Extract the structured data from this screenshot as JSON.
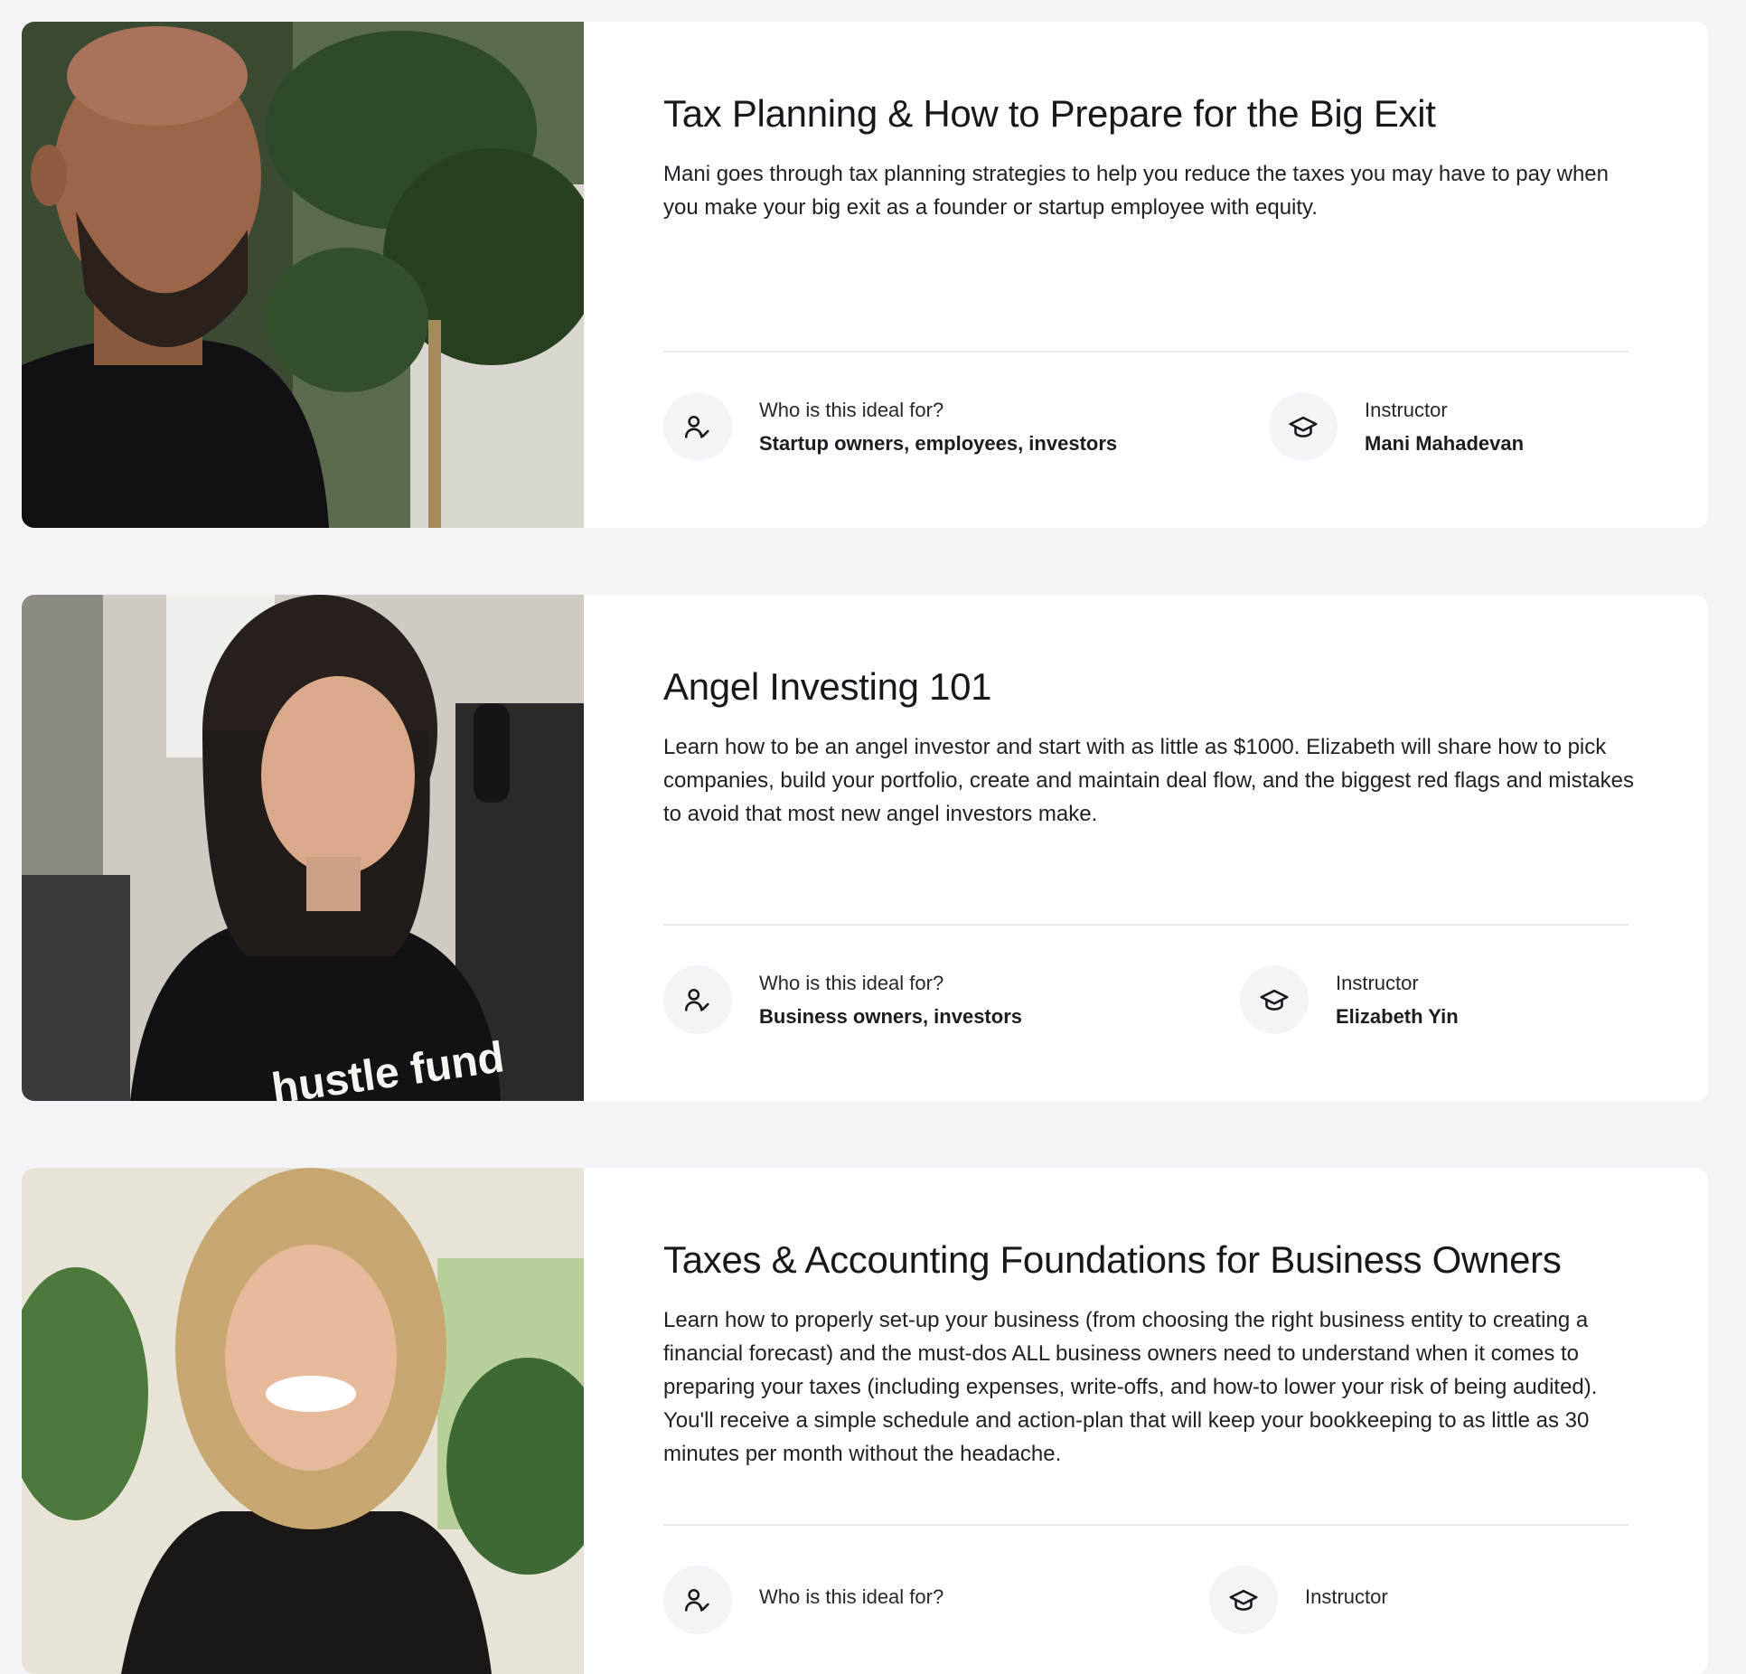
{
  "courses": [
    {
      "title": "Tax Planning & How to Prepare for the Big Exit",
      "description": "Mani goes through tax planning strategies to help you reduce the taxes you may have to pay when you make your big exit as a founder or startup employee with equity.",
      "audience_label": "Who is this ideal for?",
      "audience_value": "Startup owners, employees, investors",
      "instructor_label": "Instructor",
      "instructor_name": "Mani Mahadevan",
      "audience_icon": "users-check-icon",
      "instructor_icon": "graduation-cap-icon"
    },
    {
      "title": "Angel Investing 101",
      "description": "Learn how to be an angel investor and start with as little as $1000. Elizabeth will share how to pick companies, build your portfolio, create and maintain deal flow, and the biggest red flags and mistakes to avoid that most new angel investors make.",
      "audience_label": "Who is this ideal for?",
      "audience_value": "Business owners, investors",
      "instructor_label": "Instructor",
      "instructor_name": "Elizabeth Yin",
      "photo_text": "hustle fund",
      "audience_icon": "users-check-icon",
      "instructor_icon": "graduation-cap-icon"
    },
    {
      "title": "Taxes & Accounting Foundations for Business Owners",
      "description": "Learn how to properly set-up your business (from choosing the right business entity to creating a financial forecast) and the must-dos ALL business owners need to understand when it comes to preparing your taxes (including expenses, write-offs, and how-to lower your risk of being audited). You'll receive a simple schedule and action-plan that will keep your bookkeeping to as little as 30 minutes per month without the headache.",
      "audience_label": "Who is this ideal for?",
      "audience_value": "",
      "instructor_label": "Instructor",
      "instructor_name": "",
      "audience_icon": "users-check-icon",
      "instructor_icon": "graduation-cap-icon"
    }
  ],
  "colors": {
    "page_background": "#f4f4f8",
    "card_background": "#ffffff",
    "icon_circle": "#f4f4f8",
    "text": "#17171c"
  }
}
